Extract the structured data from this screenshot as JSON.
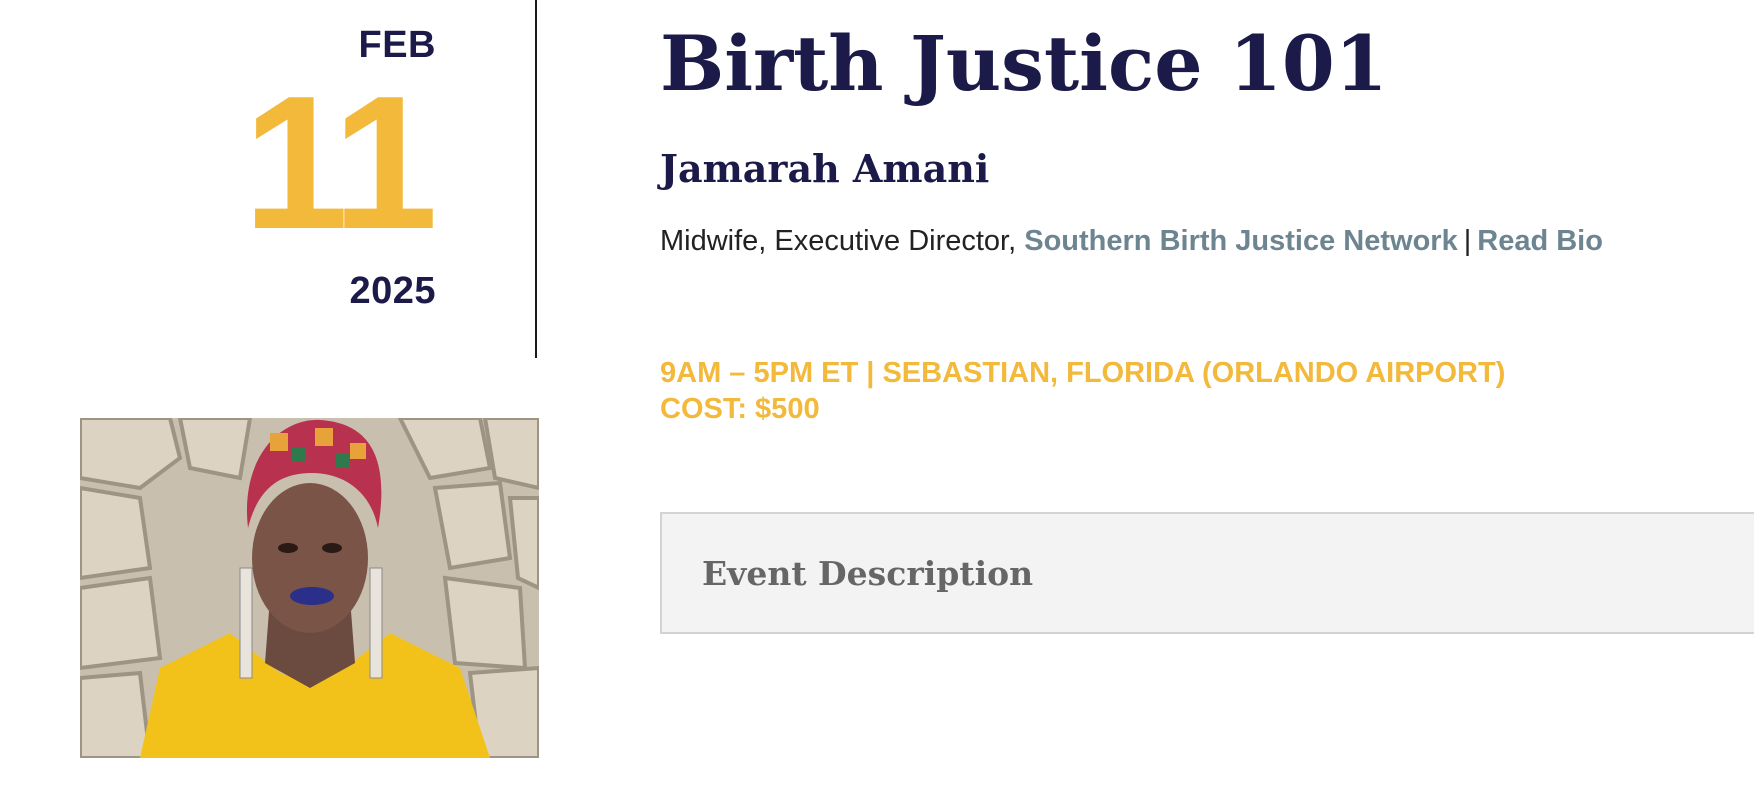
{
  "date": {
    "month": "FEB",
    "day": "11",
    "year": "2025"
  },
  "event": {
    "title": "Birth Justice 101",
    "time_location": "9AM – 5PM ET | SEBASTIAN, FLORIDA (ORLANDO AIRPORT)",
    "cost": "COST: $500"
  },
  "speaker": {
    "name": "Jamarah Amani",
    "role": "Midwife, Executive Director, ",
    "organization_link": "Southern Birth Justice Network",
    "separator": "|",
    "bio_link": "Read Bio"
  },
  "description": {
    "title": "Event Description"
  },
  "colors": {
    "navy": "#1b1a48",
    "gold": "#f2b93b",
    "link_gray_blue": "#6c8591",
    "panel_bg": "#f3f3f3"
  }
}
